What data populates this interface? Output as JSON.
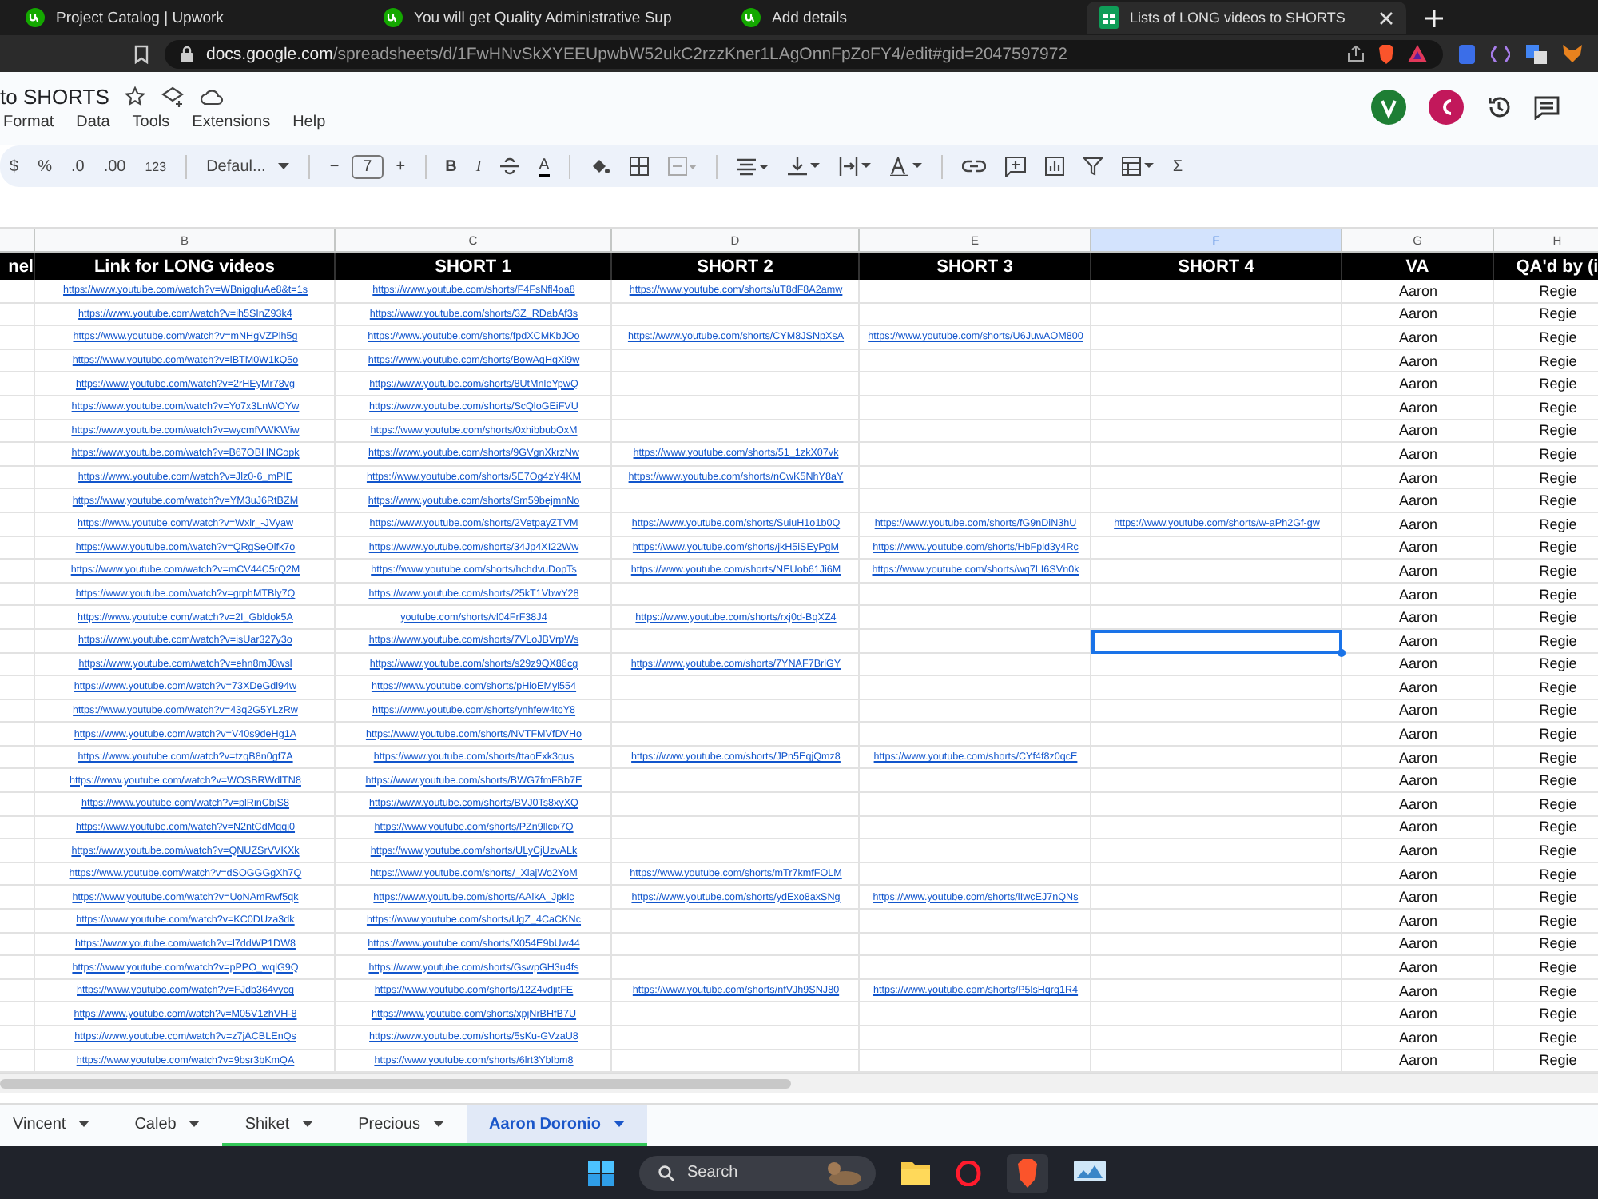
{
  "browser": {
    "tabs": [
      {
        "title": "Project Catalog | Upwork",
        "selected": false
      },
      {
        "title": "You will get Quality Administrative Sup",
        "selected": false
      },
      {
        "title": "Add details",
        "selected": false
      },
      {
        "title": "Lists of LONG videos to SHORTS",
        "selected": true
      }
    ],
    "address": {
      "host": "docs.google.com",
      "path": "/spreadsheets/d/1FwHNvSkXYEEUpwbW52ukC2rzzKner1LAgOnnFpZoFY4/edit#gid=2047597972"
    }
  },
  "document": {
    "title": "to SHORTS",
    "menu": [
      "Format",
      "Data",
      "Tools",
      "Extensions",
      "Help"
    ]
  },
  "toolbar": {
    "currency": "$",
    "percent": "%",
    "decrease_decimals": ".0",
    "increase_decimals": ".00",
    "number_format": "123",
    "font": "Defaul...",
    "decrease_size": "−",
    "font_size": "7",
    "increase_size": "+",
    "bold": "B",
    "italic": "I",
    "text_color": "A",
    "functions": "Σ"
  },
  "columns": [
    {
      "header": "nel",
      "selected": false
    },
    {
      "letter": "B",
      "header": "Link for LONG videos",
      "selected": false
    },
    {
      "letter": "C",
      "header": "SHORT 1",
      "selected": false
    },
    {
      "letter": "D",
      "header": "SHORT 2",
      "selected": false
    },
    {
      "letter": "E",
      "header": "SHORT 3",
      "selected": false
    },
    {
      "letter": "F",
      "header": "SHORT 4",
      "selected": true
    },
    {
      "letter": "G",
      "header": "VA",
      "selected": false
    },
    {
      "letter": "H",
      "header": "QA'd by (i",
      "selected": false
    }
  ],
  "rows": [
    {
      "selected": false,
      "cells": [
        null,
        "https://www.youtube.com/watch?v=WBnigqluAe8&t=1s",
        "https://www.youtube.com/shorts/F4FsNfl4oa8",
        "https://www.youtube.com/shorts/uT8dF8A2amw",
        null,
        null,
        "Aaron",
        "Regie"
      ]
    },
    {
      "selected": false,
      "cells": [
        null,
        "https://www.youtube.com/watch?v=ih5SInZ93k4",
        "https://www.youtube.com/shorts/3Z_RDabAf3s",
        null,
        null,
        null,
        "Aaron",
        "Regie"
      ]
    },
    {
      "selected": false,
      "cells": [
        null,
        "https://www.youtube.com/watch?v=mNHgVZPlh5g",
        "https://www.youtube.com/shorts/fpdXCMKbJOo",
        "https://www.youtube.com/shorts/CYM8JSNpXsA",
        "https://www.youtube.com/shorts/U6JuwAOM800",
        null,
        "Aaron",
        "Regie"
      ]
    },
    {
      "selected": false,
      "cells": [
        null,
        "https://www.youtube.com/watch?v=lBTM0W1kQ5o",
        "https://www.youtube.com/shorts/BowAgHgXi9w",
        null,
        null,
        null,
        "Aaron",
        "Regie"
      ]
    },
    {
      "selected": false,
      "cells": [
        null,
        "https://www.youtube.com/watch?v=2rHEyMr78vg",
        "https://www.youtube.com/shorts/8UtMnleYpwQ",
        null,
        null,
        null,
        "Aaron",
        "Regie"
      ]
    },
    {
      "selected": false,
      "cells": [
        null,
        "https://www.youtube.com/watch?v=Yo7x3LnWOYw",
        "https://www.youtube.com/shorts/ScQloGEiFVU",
        null,
        null,
        null,
        "Aaron",
        "Regie"
      ]
    },
    {
      "selected": false,
      "cells": [
        null,
        "https://www.youtube.com/watch?v=wycmfVWKWiw",
        "https://www.youtube.com/shorts/0xhibbubOxM",
        null,
        null,
        null,
        "Aaron",
        "Regie"
      ]
    },
    {
      "selected": false,
      "cells": [
        null,
        "https://www.youtube.com/watch?v=B67OBHNCopk",
        "https://www.youtube.com/shorts/9GVgnXkrzNw",
        "https://www.youtube.com/shorts/51_1zkX07vk",
        null,
        null,
        "Aaron",
        "Regie"
      ]
    },
    {
      "selected": false,
      "cells": [
        null,
        "https://www.youtube.com/watch?v=Jlz0-6_mPIE",
        "https://www.youtube.com/shorts/5E7Og4zY4KM",
        "https://www.youtube.com/shorts/nCwK5NhY8aY",
        null,
        null,
        "Aaron",
        "Regie"
      ]
    },
    {
      "selected": false,
      "cells": [
        null,
        "https://www.youtube.com/watch?v=YM3uJ6RtBZM",
        "https://www.youtube.com/shorts/Sm59bejmnNo",
        null,
        null,
        null,
        "Aaron",
        "Regie"
      ]
    },
    {
      "selected": false,
      "cells": [
        null,
        "https://www.youtube.com/watch?v=Wxlr_-JVyaw",
        "https://www.youtube.com/shorts/2VetpayZTVM",
        "https://www.youtube.com/shorts/SuiuH1o1b0Q",
        "https://www.youtube.com/shorts/fG9nDiN3hU",
        "https://www.youtube.com/shorts/w-aPh2Gf-gw",
        "Aaron",
        "Regie"
      ]
    },
    {
      "selected": false,
      "cells": [
        null,
        "https://www.youtube.com/watch?v=QRgSeOlfk7o",
        "https://www.youtube.com/shorts/34Jp4XI22Ww",
        "https://www.youtube.com/shorts/jkH5iSEyPgM",
        "https://www.youtube.com/shorts/HbFpld3y4Rc",
        null,
        "Aaron",
        "Regie"
      ]
    },
    {
      "selected": false,
      "cells": [
        null,
        "https://www.youtube.com/watch?v=mCV44C5rQ2M",
        "https://www.youtube.com/shorts/hchdvuDopTs",
        "https://www.youtube.com/shorts/NEUob61Ji6M",
        "https://www.youtube.com/shorts/wq7LI6SVn0k",
        null,
        "Aaron",
        "Regie"
      ]
    },
    {
      "selected": false,
      "cells": [
        null,
        "https://www.youtube.com/watch?v=grphMTBly7Q",
        "https://www.youtube.com/shorts/25kT1VbwY28",
        null,
        null,
        null,
        "Aaron",
        "Regie"
      ]
    },
    {
      "selected": false,
      "cells": [
        null,
        "https://www.youtube.com/watch?v=2I_Gbldok5A",
        "youtube.com/shorts/vl04FrF38J4",
        "https://www.youtube.com/shorts/rxj0d-BqXZ4",
        null,
        null,
        "Aaron",
        "Regie"
      ]
    },
    {
      "selected": true,
      "cells": [
        null,
        "https://www.youtube.com/watch?v=isUar327y3o",
        "https://www.youtube.com/shorts/7VLoJBVrpWs",
        null,
        null,
        null,
        "Aaron",
        "Regie"
      ]
    },
    {
      "selected": false,
      "cells": [
        null,
        "https://www.youtube.com/watch?v=ehn8mJ8wsl",
        "https://www.youtube.com/shorts/s29z9QX86cg",
        "https://www.youtube.com/shorts/7YNAF7BrlGY",
        null,
        null,
        "Aaron",
        "Regie"
      ]
    },
    {
      "selected": false,
      "cells": [
        null,
        "https://www.youtube.com/watch?v=73XDeGdl94w",
        "https://www.youtube.com/shorts/pHioEMyl554",
        null,
        null,
        null,
        "Aaron",
        "Regie"
      ]
    },
    {
      "selected": false,
      "cells": [
        null,
        "https://www.youtube.com/watch?v=43q2G5YLzRw",
        "https://www.youtube.com/shorts/ynhfew4toY8",
        null,
        null,
        null,
        "Aaron",
        "Regie"
      ]
    },
    {
      "selected": false,
      "cells": [
        null,
        "https://www.youtube.com/watch?v=V40s9deHg1A",
        "https://www.youtube.com/shorts/NVTFMVfDVHo",
        null,
        null,
        null,
        "Aaron",
        "Regie"
      ]
    },
    {
      "selected": false,
      "cells": [
        null,
        "https://www.youtube.com/watch?v=tzqB8n0gf7A",
        "https://www.youtube.com/shorts/ttaoExk3qus",
        "https://www.youtube.com/shorts/JPn5EqjQmz8",
        "https://www.youtube.com/shorts/CYf4f8z0qcE",
        null,
        "Aaron",
        "Regie"
      ]
    },
    {
      "selected": false,
      "cells": [
        null,
        "https://www.youtube.com/watch?v=WOSBRWdlTN8",
        "https://www.youtube.com/shorts/BWG7fmFBb7E",
        null,
        null,
        null,
        "Aaron",
        "Regie"
      ]
    },
    {
      "selected": false,
      "cells": [
        null,
        "https://www.youtube.com/watch?v=plRinCbjS8",
        "https://www.youtube.com/shorts/BVJ0Ts8xyXQ",
        null,
        null,
        null,
        "Aaron",
        "Regie"
      ]
    },
    {
      "selected": false,
      "cells": [
        null,
        "https://www.youtube.com/watch?v=N2ntCdMqqj0",
        "https://www.youtube.com/shorts/PZn9llcix7Q",
        null,
        null,
        null,
        "Aaron",
        "Regie"
      ]
    },
    {
      "selected": false,
      "cells": [
        null,
        "https://www.youtube.com/watch?v=QNUZSrVVKXk",
        "https://www.youtube.com/shorts/ULyCjUzvALk",
        null,
        null,
        null,
        "Aaron",
        "Regie"
      ]
    },
    {
      "selected": false,
      "cells": [
        null,
        "https://www.youtube.com/watch?v=dSOGGGgXh7Q",
        "https://www.youtube.com/shorts/_XlajWo2YoM",
        "https://www.youtube.com/shorts/mTr7kmfFOLM",
        null,
        null,
        "Aaron",
        "Regie"
      ]
    },
    {
      "selected": false,
      "cells": [
        null,
        "https://www.youtube.com/watch?v=UoNAmRwf5qk",
        "https://www.youtube.com/shorts/AAlkA_Jpklc",
        "https://www.youtube.com/shorts/ydExo8axSNg",
        "https://www.youtube.com/shorts/lIwcEJ7nQNs",
        null,
        "Aaron",
        "Regie"
      ]
    },
    {
      "selected": false,
      "cells": [
        null,
        "https://www.youtube.com/watch?v=KC0DUza3dk",
        "https://www.youtube.com/shorts/UgZ_4CaCKNc",
        null,
        null,
        null,
        "Aaron",
        "Regie"
      ]
    },
    {
      "selected": false,
      "cells": [
        null,
        "https://www.youtube.com/watch?v=l7ddWP1DW8",
        "https://www.youtube.com/shorts/X054E9bUw44",
        null,
        null,
        null,
        "Aaron",
        "Regie"
      ]
    },
    {
      "selected": false,
      "cells": [
        null,
        "https://www.youtube.com/watch?v=pPPO_wqlG9Q",
        "https://www.youtube.com/shorts/GswpGH3u4fs",
        null,
        null,
        null,
        "Aaron",
        "Regie"
      ]
    },
    {
      "selected": false,
      "cells": [
        null,
        "https://www.youtube.com/watch?v=FJdb364vycg",
        "https://www.youtube.com/shorts/12Z4vdjitFE",
        "https://www.youtube.com/shorts/nfVJh9SNJ80",
        "https://www.youtube.com/shorts/P5lsHqrg1R4",
        null,
        "Aaron",
        "Regie"
      ]
    },
    {
      "selected": false,
      "cells": [
        null,
        "https://www.youtube.com/watch?v=M05V1zhVH-8",
        "https://www.youtube.com/shorts/xpjNrBHfB7U",
        null,
        null,
        null,
        "Aaron",
        "Regie"
      ]
    },
    {
      "selected": false,
      "cells": [
        null,
        "https://www.youtube.com/watch?v=z7jACBLEnQs",
        "https://www.youtube.com/shorts/5sKu-GVzaU8",
        null,
        null,
        null,
        "Aaron",
        "Regie"
      ]
    },
    {
      "selected": false,
      "cells": [
        null,
        "https://www.youtube.com/watch?v=9bsr3bKmQA",
        "https://www.youtube.com/shorts/6lrt3YbIbm8",
        null,
        null,
        null,
        "Aaron",
        "Regie"
      ]
    }
  ],
  "sheet_tabs": [
    {
      "name": "Vincent",
      "selected": false
    },
    {
      "name": "Caleb",
      "selected": false
    },
    {
      "name": "Shiket",
      "selected": false,
      "color": "#34c759"
    },
    {
      "name": "Precious",
      "selected": false,
      "color": "#34c759"
    },
    {
      "name": "Aaron Doronio",
      "selected": true,
      "color": "#34c759"
    }
  ],
  "taskbar": {
    "search": "Search"
  }
}
